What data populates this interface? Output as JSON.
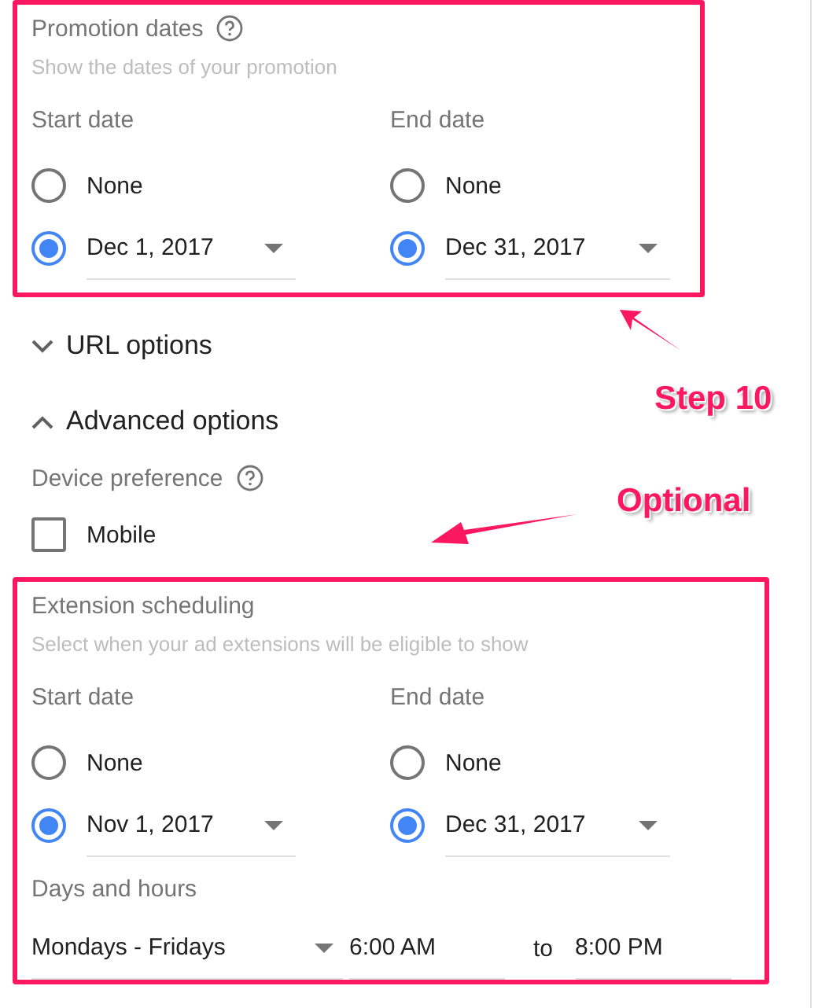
{
  "promotion_dates": {
    "title": "Promotion dates",
    "hint": "Show the dates of your promotion",
    "highlighted": true,
    "columns": [
      {
        "label": "Start date",
        "options": [
          {
            "kind": "none",
            "label": "None",
            "selected": false
          },
          {
            "kind": "date",
            "label": "Dec 1, 2017",
            "selected": true
          }
        ]
      },
      {
        "label": "End date",
        "options": [
          {
            "kind": "none",
            "label": "None",
            "selected": false
          },
          {
            "kind": "date",
            "label": "Dec 31, 2017",
            "selected": true
          }
        ]
      }
    ]
  },
  "url_options": {
    "label": "URL options",
    "expanded": false
  },
  "advanced_options": {
    "label": "Advanced options",
    "expanded": true
  },
  "device_preference": {
    "label": "Device preference",
    "options": [
      {
        "label": "Mobile",
        "checked": false
      }
    ]
  },
  "extension_scheduling": {
    "title": "Extension scheduling",
    "hint": "Select when your ad extensions will be eligible to show",
    "highlighted": true,
    "columns": [
      {
        "label": "Start date",
        "options": [
          {
            "kind": "none",
            "label": "None",
            "selected": false
          },
          {
            "kind": "date",
            "label": "Nov 1, 2017",
            "selected": true
          }
        ]
      },
      {
        "label": "End date",
        "options": [
          {
            "kind": "none",
            "label": "None",
            "selected": false
          },
          {
            "kind": "date",
            "label": "Dec 31, 2017",
            "selected": true
          }
        ]
      }
    ],
    "days_and_hours": {
      "label": "Days and hours",
      "days": "Mondays - Fridays",
      "from": "6:00 AM",
      "separator": "to",
      "to": "8:00 PM"
    }
  },
  "annotations": [
    {
      "kind": "step",
      "text": "Step 10"
    },
    {
      "kind": "optional",
      "text": "Optional"
    }
  ]
}
